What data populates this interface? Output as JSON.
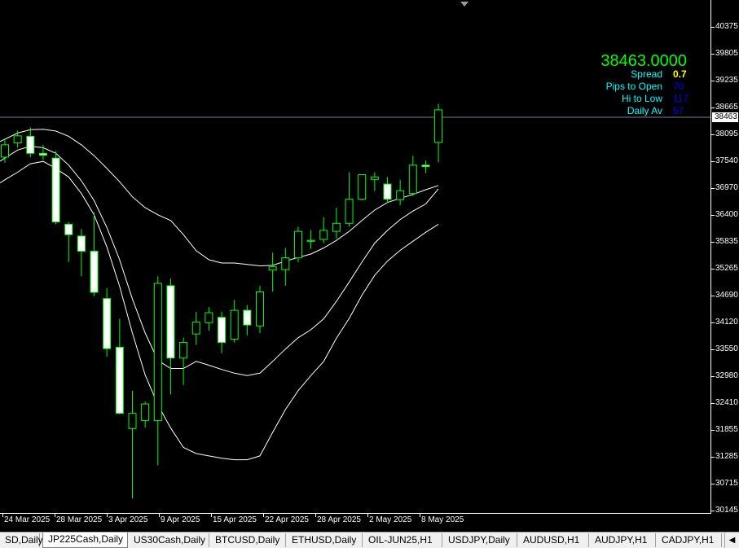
{
  "chart_data": {
    "type": "candlestick",
    "symbol": "JP225Cash",
    "timeframe": "Daily",
    "current_price": "38463",
    "y_ticks": [
      "40375",
      "39805",
      "39235",
      "38665",
      "38095",
      "37540",
      "36970",
      "36400",
      "35835",
      "35265",
      "34690",
      "34120",
      "33550",
      "32980",
      "32410",
      "31855",
      "31285",
      "30715",
      "30145"
    ],
    "x_ticks": [
      "24 Mar 2025",
      "28 Mar 2025",
      "3 Apr 2025",
      "9 Apr 2025",
      "15 Apr 2025",
      "22 Apr 2025",
      "28 Apr 2025",
      "2 May 2025",
      "8 May 2025"
    ],
    "candles": [
      {
        "o": 37620,
        "h": 38000,
        "l": 37500,
        "c": 37880
      },
      {
        "o": 37920,
        "h": 38180,
        "l": 37820,
        "c": 38070
      },
      {
        "o": 38060,
        "h": 38250,
        "l": 37620,
        "c": 37700
      },
      {
        "o": 37700,
        "h": 37880,
        "l": 37560,
        "c": 37660
      },
      {
        "o": 37600,
        "h": 37750,
        "l": 36200,
        "c": 36250
      },
      {
        "o": 36200,
        "h": 36250,
        "l": 35400,
        "c": 35980
      },
      {
        "o": 35950,
        "h": 36100,
        "l": 35100,
        "c": 35630
      },
      {
        "o": 35630,
        "h": 36450,
        "l": 34680,
        "c": 34760
      },
      {
        "o": 34630,
        "h": 34850,
        "l": 33400,
        "c": 33570
      },
      {
        "o": 33600,
        "h": 34200,
        "l": 32180,
        "c": 32200
      },
      {
        "o": 31880,
        "h": 32680,
        "l": 30400,
        "c": 32200
      },
      {
        "o": 32050,
        "h": 32450,
        "l": 31900,
        "c": 32400
      },
      {
        "o": 32050,
        "h": 35100,
        "l": 31100,
        "c": 34950
      },
      {
        "o": 34900,
        "h": 35050,
        "l": 32600,
        "c": 33370
      },
      {
        "o": 33370,
        "h": 33800,
        "l": 32800,
        "c": 33700
      },
      {
        "o": 33880,
        "h": 34350,
        "l": 33650,
        "c": 34130
      },
      {
        "o": 34120,
        "h": 34450,
        "l": 33950,
        "c": 34330
      },
      {
        "o": 34230,
        "h": 34350,
        "l": 33470,
        "c": 33700
      },
      {
        "o": 33770,
        "h": 34600,
        "l": 33700,
        "c": 34380
      },
      {
        "o": 34380,
        "h": 34490,
        "l": 33850,
        "c": 34070
      },
      {
        "o": 34050,
        "h": 34900,
        "l": 33900,
        "c": 34770
      },
      {
        "o": 35230,
        "h": 35600,
        "l": 34780,
        "c": 35300
      },
      {
        "o": 35240,
        "h": 35700,
        "l": 34900,
        "c": 35490
      },
      {
        "o": 35490,
        "h": 36150,
        "l": 35400,
        "c": 36050
      },
      {
        "o": 35840,
        "h": 36080,
        "l": 35680,
        "c": 35860
      },
      {
        "o": 35880,
        "h": 36350,
        "l": 35800,
        "c": 36070
      },
      {
        "o": 36050,
        "h": 36550,
        "l": 35900,
        "c": 36220
      },
      {
        "o": 36220,
        "h": 37300,
        "l": 36150,
        "c": 36730
      },
      {
        "o": 36730,
        "h": 37250,
        "l": 36700,
        "c": 37250
      },
      {
        "o": 37150,
        "h": 37300,
        "l": 36900,
        "c": 37200
      },
      {
        "o": 37050,
        "h": 37200,
        "l": 36650,
        "c": 36730
      },
      {
        "o": 36720,
        "h": 37140,
        "l": 36600,
        "c": 36910
      },
      {
        "o": 36850,
        "h": 37650,
        "l": 36800,
        "c": 37450
      },
      {
        "o": 37450,
        "h": 37550,
        "l": 37280,
        "c": 37420
      },
      {
        "o": 37930,
        "h": 38750,
        "l": 37510,
        "c": 38620
      }
    ],
    "band_upper": [
      38000,
      38130,
      38200,
      38210,
      38170,
      38060,
      37880,
      37650,
      37380,
      37100,
      36780,
      36550,
      36400,
      36280,
      35980,
      35640,
      35450,
      35380,
      35380,
      35350,
      35320,
      35330,
      35420,
      35500,
      35570,
      35700,
      35860,
      36050,
      36280,
      36500,
      36660,
      36750,
      36830,
      36930,
      37020
    ],
    "band_middle": [
      37600,
      37770,
      37850,
      37820,
      37700,
      37450,
      37120,
      36700,
      36130,
      35450,
      34620,
      33900,
      33320,
      33150,
      33150,
      33300,
      33220,
      33130,
      33050,
      33000,
      33050,
      33300,
      33560,
      33800,
      33970,
      34200,
      34570,
      34980,
      35400,
      35800,
      36070,
      36300,
      36480,
      36630,
      36950
    ],
    "band_lower": [
      37140,
      37300,
      37480,
      37530,
      37380,
      37200,
      36850,
      36400,
      35720,
      34890,
      33900,
      33010,
      32380,
      31890,
      31480,
      31350,
      31300,
      31250,
      31220,
      31220,
      31300,
      31800,
      32280,
      32680,
      33000,
      33300,
      33790,
      34210,
      34700,
      35120,
      35420,
      35650,
      35840,
      36030,
      36200
    ],
    "colors": {
      "background": "#000000",
      "candle": "#00ff00",
      "bull_body": "#000000",
      "bear_body": "#ffffff",
      "bands": "#ffffff",
      "price_line": "#708090"
    }
  },
  "info": {
    "price": "38463.0000",
    "rows": [
      {
        "label": "Spread",
        "value": "0.7",
        "label_color": "#00ffff",
        "value_color": "#ffff00"
      },
      {
        "label": "Pips to Open",
        "value": "70",
        "label_color": "#00ffff",
        "value_color": "#0000ff"
      },
      {
        "label": "Hi to Low",
        "value": "117",
        "label_color": "#00ffff",
        "value_color": "#0000ff"
      },
      {
        "label": "Daily Av",
        "value": "57",
        "label_color": "#00ffff",
        "value_color": "#0000ff"
      }
    ],
    "price_color": "#00ff00"
  },
  "tabs": [
    {
      "label": "SD,Daily",
      "active": false
    },
    {
      "label": "JP225Cash,Daily",
      "active": true
    },
    {
      "label": "US30Cash,Daily",
      "active": false
    },
    {
      "label": "BTCUSD,Daily",
      "active": false
    },
    {
      "label": "ETHUSD,Daily",
      "active": false
    },
    {
      "label": "OIL-JUN25,H1",
      "active": false
    },
    {
      "label": "USDJPY,Daily",
      "active": false
    },
    {
      "label": "AUDUSD,H1",
      "active": false
    },
    {
      "label": "AUDJPY,H1",
      "active": false
    },
    {
      "label": "CADJPY,H1",
      "active": false
    }
  ],
  "tab_scroll_icon": "chevron-left-icon"
}
